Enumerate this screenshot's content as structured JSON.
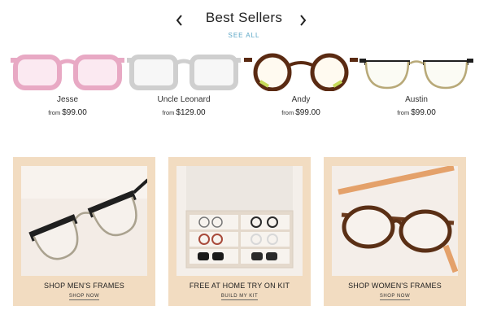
{
  "section": {
    "title": "Best Sellers",
    "see_all": "SEE ALL",
    "prev_icon": "chevron-left-icon",
    "next_icon": "chevron-right-icon"
  },
  "products": [
    {
      "name": "Jesse",
      "from_label": "from",
      "price": "$99.00",
      "frame_color": "#e8a9c4"
    },
    {
      "name": "Uncle Leonard",
      "from_label": "from",
      "price": "$129.00",
      "frame_color": "#d9d9d9"
    },
    {
      "name": "Andy",
      "from_label": "from",
      "price": "$99.00",
      "frame_color": "#5a2a12"
    },
    {
      "name": "Austin",
      "from_label": "from",
      "price": "$99.00",
      "frame_color": "#1e1e1e"
    }
  ],
  "promos": [
    {
      "title": "SHOP MEN'S FRAMES",
      "link": "SHOP NOW"
    },
    {
      "title": "FREE AT HOME TRY ON KIT",
      "link": "BUILD MY KIT"
    },
    {
      "title": "SHOP WOMEN'S FRAMES",
      "link": "SHOP NOW"
    }
  ],
  "colors": {
    "promo_background": "#f2dcc1",
    "link_accent": "#5aa6c6"
  }
}
